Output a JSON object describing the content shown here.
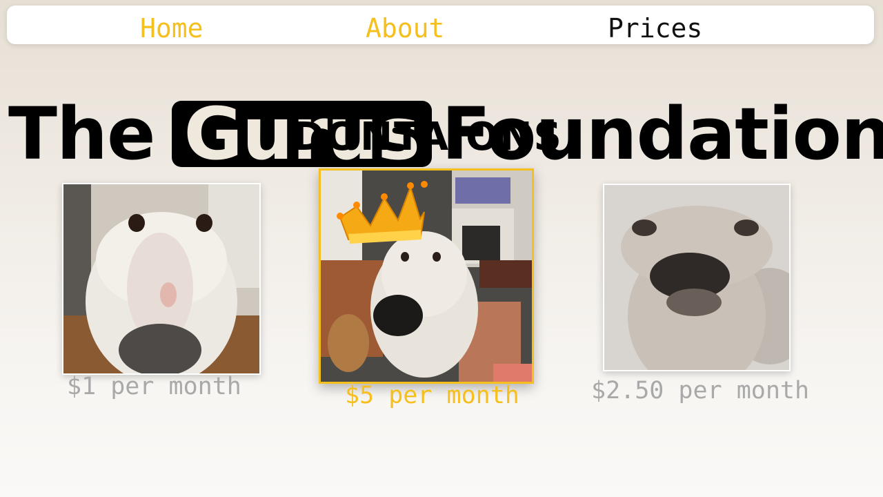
{
  "nav": {
    "home_label": "Home",
    "about_label": "About",
    "prices_label": "Prices",
    "active_color": "#111111",
    "link_color": "#f5bf1d"
  },
  "header": {
    "title_prefix": "The",
    "title_highlight": "Gurus",
    "title_suffix": "Foundation",
    "subtitle": "DONTAIONS"
  },
  "tiers": [
    {
      "image": "borzoi-closeup-photo",
      "price": "$1 per month",
      "featured": false
    },
    {
      "image": "crowned-doodle-photo",
      "price": "$5 per month",
      "featured": true
    },
    {
      "image": "blurry-dog-photo",
      "price": "$2.50 per month",
      "featured": false
    }
  ],
  "colors": {
    "accent": "#f5bf1d",
    "muted": "#a9a9a9",
    "title": "#000000",
    "highlight_text": "#efe8dc"
  }
}
